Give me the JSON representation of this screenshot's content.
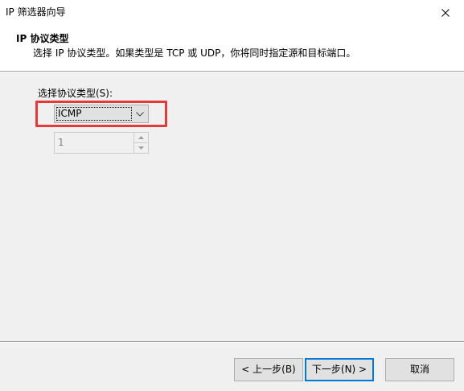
{
  "window": {
    "title": "IP 筛选器向导"
  },
  "header": {
    "title": "IP 协议类型",
    "description": "选择 IP 协议类型。如果类型是 TCP 或 UDP，你将同时指定源和目标端口。"
  },
  "form": {
    "protocol_label": "选择协议类型(S):",
    "protocol_value": "ICMP",
    "protocol_number": "1"
  },
  "buttons": {
    "back": "< 上一步(B)",
    "next": "下一步(N) >",
    "cancel": "取消"
  },
  "colors": {
    "highlight": "#e23b3b",
    "default_button_border": "#0078d7"
  },
  "icons": {
    "close": "close-icon",
    "combo": "chevron-down-icon",
    "spin_up": "spin-up-icon",
    "spin_down": "spin-down-icon"
  }
}
